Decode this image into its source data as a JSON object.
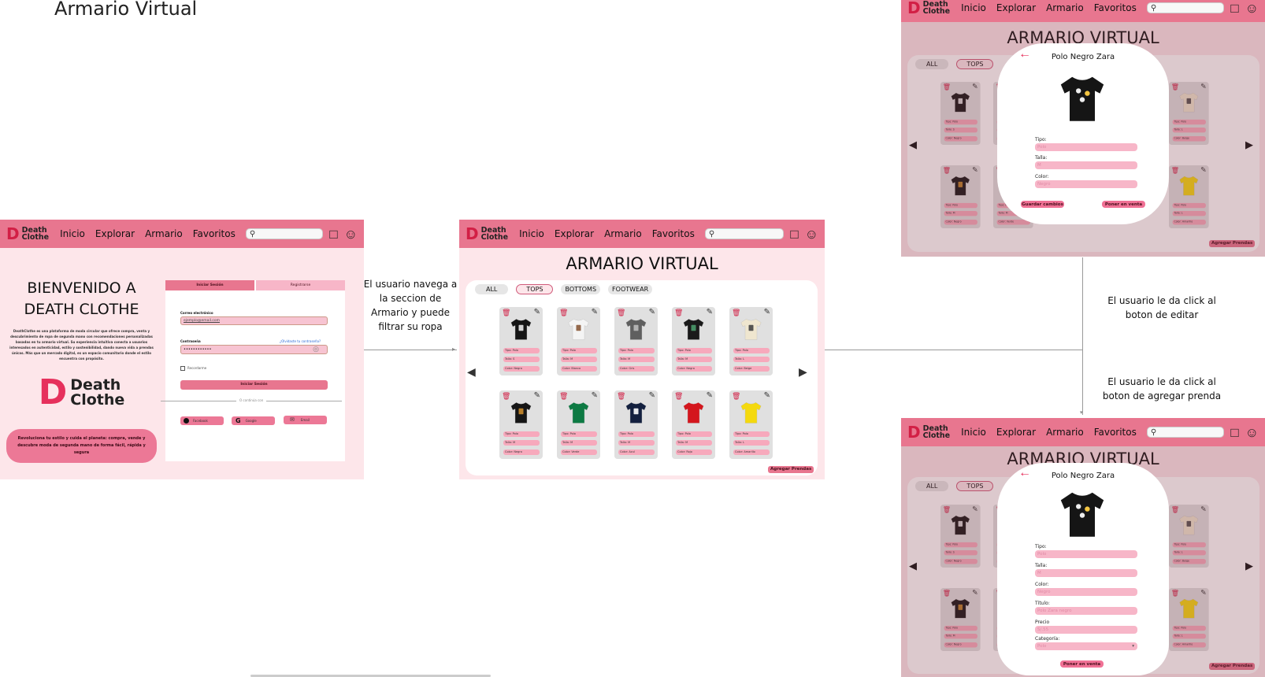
{
  "page_title": "Armario Virtual",
  "nav": {
    "logo_line1": "Death",
    "logo_line2": "Clothe",
    "inicio": "Inicio",
    "explorar": "Explorar",
    "armario": "Armario",
    "favoritos": "Favoritos"
  },
  "login": {
    "welcome_line1": "BIENVENIDO A",
    "welcome_line2": "DEATH CLOTHE",
    "description": "DeathClothe es una plataforma de moda circular que ofrece compra, venta y descubrimiento de ropa de segunda mano con recomendaciones personalizadas basadas en tu armario virtual. Su experiencia intuitiva conecta a usuarios interesados en autenticidad, estilo y sostenibilidad, dando nueva vida a prendas únicas. Más que un mercado digital, es un espacio comunitario donde el estilo encuentra con propósito.",
    "logo_line1": "Death",
    "logo_line2": "Clothe",
    "slogan": "Revoluciona tu estilo y cuida el planeta: compra, vende y descubre moda de segunda mano de forma fácil, rápida y segura",
    "tab_login": "Iniciar Sesión",
    "tab_register": "Registrarse",
    "email_label": "Correo electrónico",
    "email_placeholder": "ejemplo@email.com",
    "password_label": "Contraseña",
    "forgot": "¿Olvidaste tu contraseña?",
    "password_value": "••••••••••••",
    "remember": "Recordarme",
    "submit": "Iniciar Sesión",
    "or": "O continúa con",
    "facebook": "Facebook",
    "google": "Google",
    "email_btn": "Email"
  },
  "notes": {
    "navigate": "El usuario navega a la seccion de Armario y puede filtrar su ropa",
    "edit": "El usuario le da click al boton de editar",
    "add": "El usuario le da click al boton de agregar prenda"
  },
  "closet": {
    "title": "ARMARIO VIRTUAL",
    "filters": [
      "ALL",
      "TOPS",
      "BOTTOMS",
      "FOOTWEAR"
    ],
    "add_button": "Agregar Prendas",
    "items": [
      {
        "tipo": "Tipo: Polo",
        "talla": "Talla: S",
        "color": "Color: Negro",
        "shirt": "#151515",
        "print": "#e8e8e8"
      },
      {
        "tipo": "Tipo: Polo",
        "talla": "Talla: M",
        "color": "Color: Blanco",
        "shirt": "#f4f4f4",
        "print": "#8a5a3a"
      },
      {
        "tipo": "Tipo: Polo",
        "talla": "Talla: M",
        "color": "Color: Gris",
        "shirt": "#5f5f5f",
        "print": "#bbbbbb"
      },
      {
        "tipo": "Tipo: Polo",
        "talla": "Talla: M",
        "color": "Color: Negro",
        "shirt": "#1a1a1a",
        "print": "#4a9a6a"
      },
      {
        "tipo": "Tipo: Polo",
        "talla": "Talla: L",
        "color": "Color: Beige",
        "shirt": "#efe6cf",
        "print": "#444444"
      },
      {
        "tipo": "Tipo: Polo",
        "talla": "Talla: M",
        "color": "Color: Negro",
        "shirt": "#161616",
        "print": "#c9892b"
      },
      {
        "tipo": "Tipo: Polo",
        "talla": "Talla: M",
        "color": "Color: Verde",
        "shirt": "#0d7a43",
        "print": "#0d7a43"
      },
      {
        "tipo": "Tipo: Polo",
        "talla": "Talla: M",
        "color": "Color: Azul",
        "shirt": "#13203f",
        "print": "#ffffff"
      },
      {
        "tipo": "Tipo: Polo",
        "talla": "Talla: M",
        "color": "Color: Rojo",
        "shirt": "#d4161d",
        "print": "#d4161d"
      },
      {
        "tipo": "Tipo: Polo",
        "talla": "Talla: L",
        "color": "Color: Amarillo",
        "shirt": "#f4d90e",
        "print": "#f4d90e"
      }
    ]
  },
  "edit_modal": {
    "title": "Polo Negro Zara",
    "tipo_label": "Tipo:",
    "tipo": "Polo",
    "talla_label": "Talla:",
    "talla": "M",
    "color_label": "Color:",
    "color": "Negro",
    "save": "Guardar cambios",
    "sell": "Poner en venta"
  },
  "add_modal": {
    "title": "Polo Negro Zara",
    "tipo_label": "Tipo:",
    "tipo": "Polo",
    "talla_label": "Talla:",
    "talla": "M",
    "color_label": "Color:",
    "color": "Negro",
    "titulo_label": "Título:",
    "titulo": "Polo Zara negro",
    "precio_label": "Precio",
    "precio": "S/.55",
    "categoria_label": "Categoría:",
    "categoria": "Polo",
    "sell": "Poner en venta"
  },
  "colors": {
    "nav": "#e8768f",
    "brand": "#d21f45",
    "background": "#fde6ea",
    "field": "#f7b6c8"
  }
}
